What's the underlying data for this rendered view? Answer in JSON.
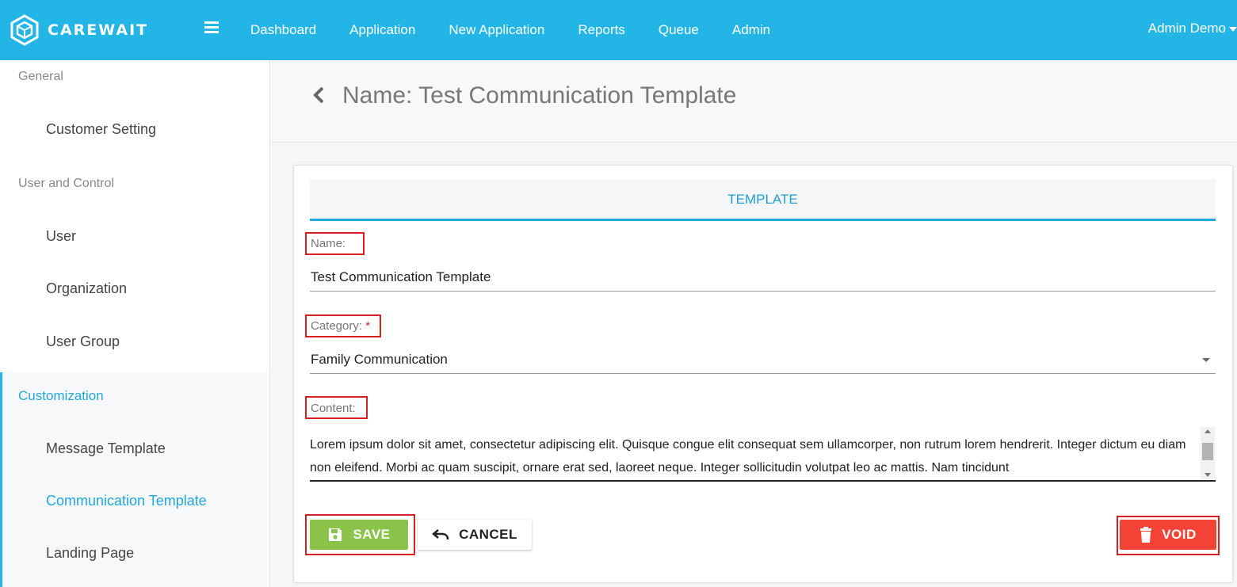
{
  "app": {
    "brand": "CAREWAIT",
    "brand_icon": "carewait-cube-logo-icon"
  },
  "topnav": {
    "menu_icon": "hamburger-icon",
    "items": [
      "Dashboard",
      "Application",
      "New Application",
      "Reports",
      "Queue",
      "Admin"
    ],
    "user": "Admin Demo"
  },
  "sidebar": {
    "groups": {
      "general": "General",
      "user_control": "User and Control",
      "customization": "Customization"
    },
    "items": {
      "customer_setting": "Customer Setting",
      "user": "User",
      "organization": "Organization",
      "user_group": "User Group",
      "message_template": "Message Template",
      "communication_template": "Communication Template",
      "landing_page": "Landing Page"
    },
    "active_item": "Communication Template"
  },
  "header": {
    "back_icon": "chevron-left-icon",
    "title": "Name: Test Communication Template"
  },
  "form": {
    "tab": "TEMPLATE",
    "name_label": "Name:",
    "name_value": "Test Communication Template",
    "category_label": "Category:",
    "category_required": "*",
    "category_value": "Family Communication",
    "content_label": "Content:",
    "content_value": "Lorem ipsum dolor sit amet, consectetur adipiscing elit. Quisque congue elit consequat sem ullamcorper, non rutrum lorem hendrerit. Integer dictum eu diam non eleifend. Morbi ac quam suscipit, ornare erat sed, laoreet neque. Integer sollicitudin volutpat leo ac mattis. Nam tincidunt"
  },
  "buttons": {
    "save": "SAVE",
    "cancel": "CANCEL",
    "void": "VOID"
  },
  "colors": {
    "primary": "#22b5e5",
    "save": "#8bc34a",
    "void": "#f44336",
    "highlight": "#d42020"
  }
}
